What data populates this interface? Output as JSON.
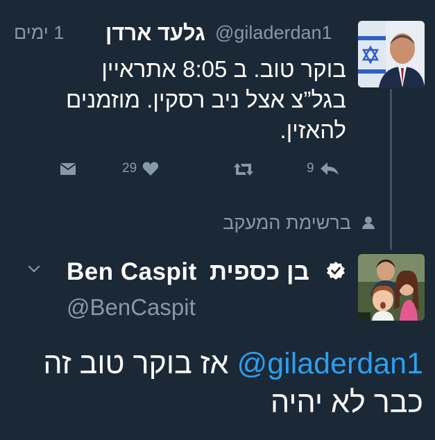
{
  "tweet": {
    "author_name": "גלעד ארדן",
    "handle": "@giladerdan1",
    "time": "1 ימים",
    "text_line1": "בוקר טוב. ב 8:05 אתראיין",
    "text_line2": "בגל”צ אצל ניב רסקין. מוזמנים",
    "text_line3": "להאזין.",
    "likes": "29",
    "replies": "9",
    "icons": {
      "dm": "envelope-icon",
      "like": "heart-icon",
      "retweet": "retweet-icon",
      "reply": "reply-icon"
    }
  },
  "followed_context": {
    "label": "ברשימת המעקב",
    "icon": "person-icon"
  },
  "reply": {
    "name_hebrew": "בן כספית",
    "name_english": "Ben Caspit",
    "handle": "@BenCaspit",
    "mention": "@giladerdan1",
    "text_rest_line1": "אז בוקר טוב זה",
    "text_line2": "כבר לא יהיה",
    "icons": {
      "verified": "verified-badge-icon",
      "menu": "chevron-down-icon"
    }
  },
  "colors": {
    "background": "#1b2836",
    "secondary_text": "#8899a6",
    "link": "#2b9ff0",
    "thread_line": "#3d5466"
  }
}
